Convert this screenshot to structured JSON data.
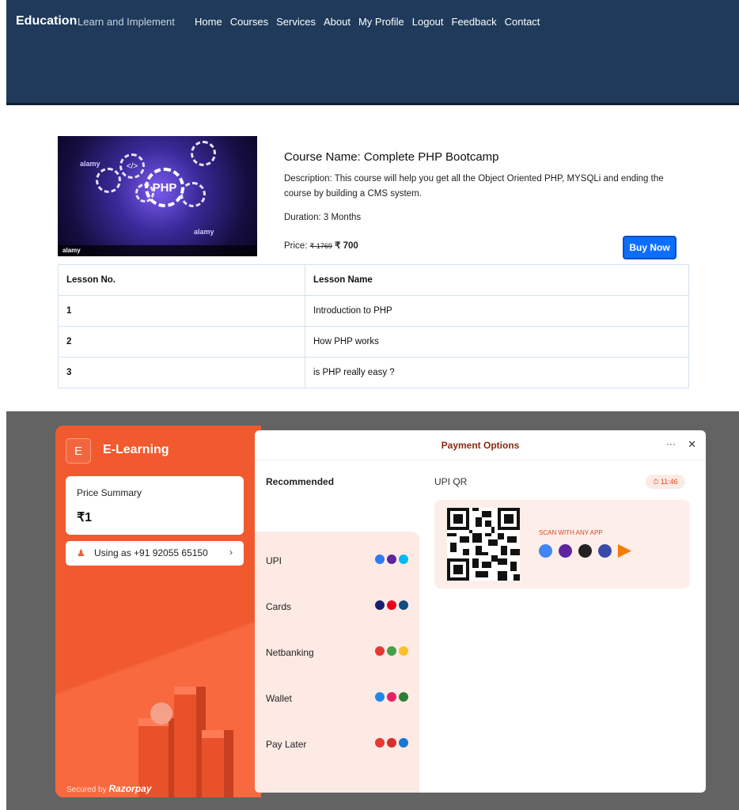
{
  "site": {
    "brand": "Education",
    "tagline": "Learn and Implement",
    "nav": [
      "Home",
      "Courses",
      "Services",
      "About",
      "My Profile",
      "Logout",
      "Feedback",
      "Contact"
    ]
  },
  "course": {
    "image_text": "PHP",
    "image_watermark": "alamy",
    "title": "Course Name: Complete PHP Bootcamp",
    "description": "Description: This course will help you get all the Object Oriented PHP, MYSQLi and ending the course by building a CMS system.",
    "duration": "Duration: 3 Months",
    "price_label": "Price:",
    "old_price": "₹ 1769",
    "new_price": "₹ 700",
    "buy_label": "Buy Now"
  },
  "lessons": {
    "headers": [
      "Lesson No.",
      "Lesson Name"
    ],
    "rows": [
      [
        "1",
        "Introduction to PHP"
      ],
      [
        "2",
        "How PHP works"
      ],
      [
        "3",
        "is PHP really easy ?"
      ]
    ]
  },
  "checkout": {
    "logo_letter": "E",
    "merchant": "E-Learning",
    "price_summary_label": "Price Summary",
    "amount": "₹1",
    "user": "Using as +91 92055 65150",
    "secured_prefix": "Secured by",
    "secured_brand": "Razorpay",
    "title": "Payment Options",
    "recommended": "Recommended",
    "methods": [
      "UPI",
      "Cards",
      "Netbanking",
      "Wallet",
      "Pay Later"
    ],
    "upi_qr_label": "UPI QR",
    "timer": "11:46",
    "scan_text": "SCAN WITH ANY APP"
  },
  "colors": {
    "navbar": "#1f3a5a",
    "razorpay_orange": "#f15a2f",
    "buy_button": "#0d6efd"
  }
}
